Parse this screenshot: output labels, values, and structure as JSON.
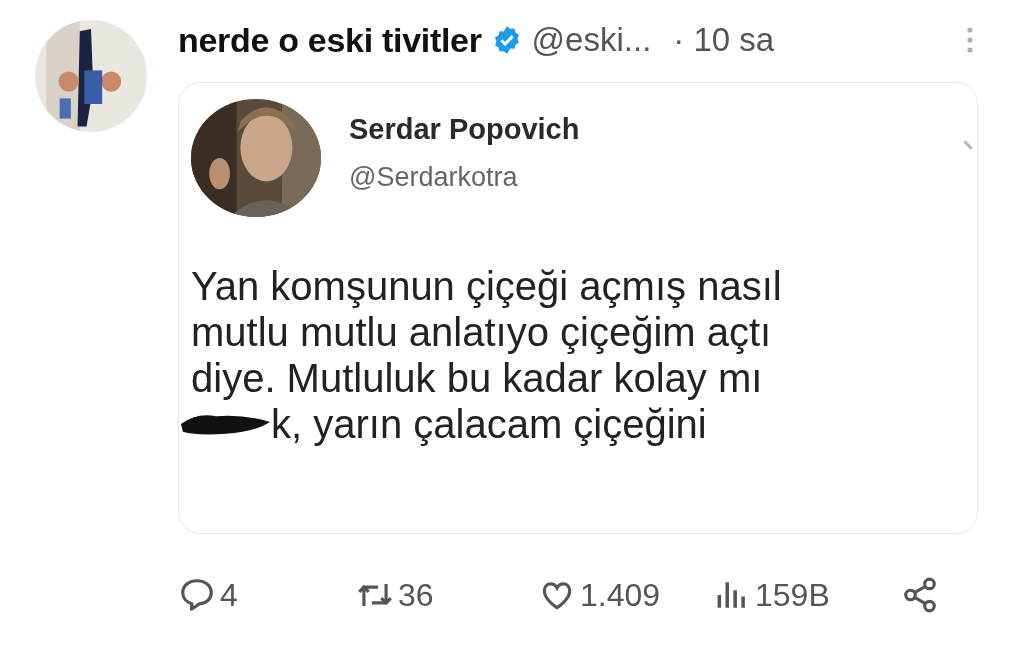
{
  "tweet": {
    "author_name": "nerde o eski tivitler",
    "verified": true,
    "handle": "@eski...",
    "time": "· 10 sa",
    "quoted": {
      "author_name": "Serdar Popovich",
      "handle": "@Serdarkotra",
      "lines": [
        {
          "text": "Yan komşunun çiçeği açmış nasıl",
          "redacted": false
        },
        {
          "text": "mutlu mutlu anlatıyo çiçeğim açtı",
          "redacted": false
        },
        {
          "text": "diye. Mutluluk bu kadar kolay mı",
          "redacted": false
        },
        {
          "text": "k, yarın çalacam çiçeğini",
          "redacted": true
        }
      ]
    },
    "actions": [
      {
        "kind": "reply",
        "count": "4"
      },
      {
        "kind": "retweet",
        "count": "36"
      },
      {
        "kind": "like",
        "count": "1.409"
      },
      {
        "kind": "views",
        "count": "159B"
      },
      {
        "kind": "share"
      }
    ]
  }
}
